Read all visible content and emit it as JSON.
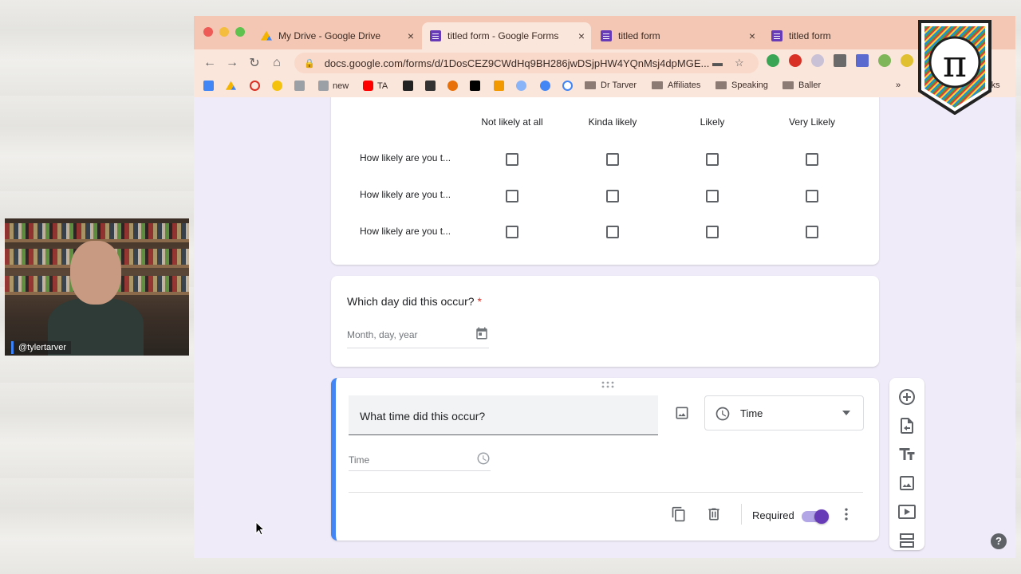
{
  "browser": {
    "tabs": [
      {
        "label": "My Drive - Google Drive",
        "icon": "google-drive-icon"
      },
      {
        "label": "titled form - Google Forms",
        "icon": "google-forms-icon"
      },
      {
        "label": "titled form",
        "icon": "google-forms-icon"
      },
      {
        "label": "titled form",
        "icon": "google-forms-icon"
      }
    ],
    "url": "docs.google.com/forms/d/1DosCEZ9CWdHq9BH286jwDSjpHW4YQnMsj4dpMGE...",
    "bookmarks": [
      "new",
      "TA",
      "Dr Tarver",
      "Affiliates",
      "Speaking",
      "Baller"
    ],
    "bookmarks_overflow": "»",
    "bookmarks_cut": "rks"
  },
  "grid_question": {
    "columns": [
      "Not likely at all",
      "Kinda likely",
      "Likely",
      "Very Likely"
    ],
    "rows": [
      "How likely are you t...",
      "How likely are you t...",
      "How likely are you t..."
    ]
  },
  "date_question": {
    "title": "Which day did this occur?",
    "required_mark": "*",
    "placeholder": "Month, day, year"
  },
  "time_question": {
    "title": "What time did this occur?",
    "type": "Time",
    "field_label": "Time",
    "required_label": "Required",
    "required": true
  },
  "webcam": {
    "handle": "@tylertarver"
  },
  "logo": {
    "symbol": "π"
  },
  "help": {
    "label": "?"
  },
  "colors": {
    "accent": "#673ab7",
    "active_border": "#4285f4",
    "required": "#d93025"
  }
}
